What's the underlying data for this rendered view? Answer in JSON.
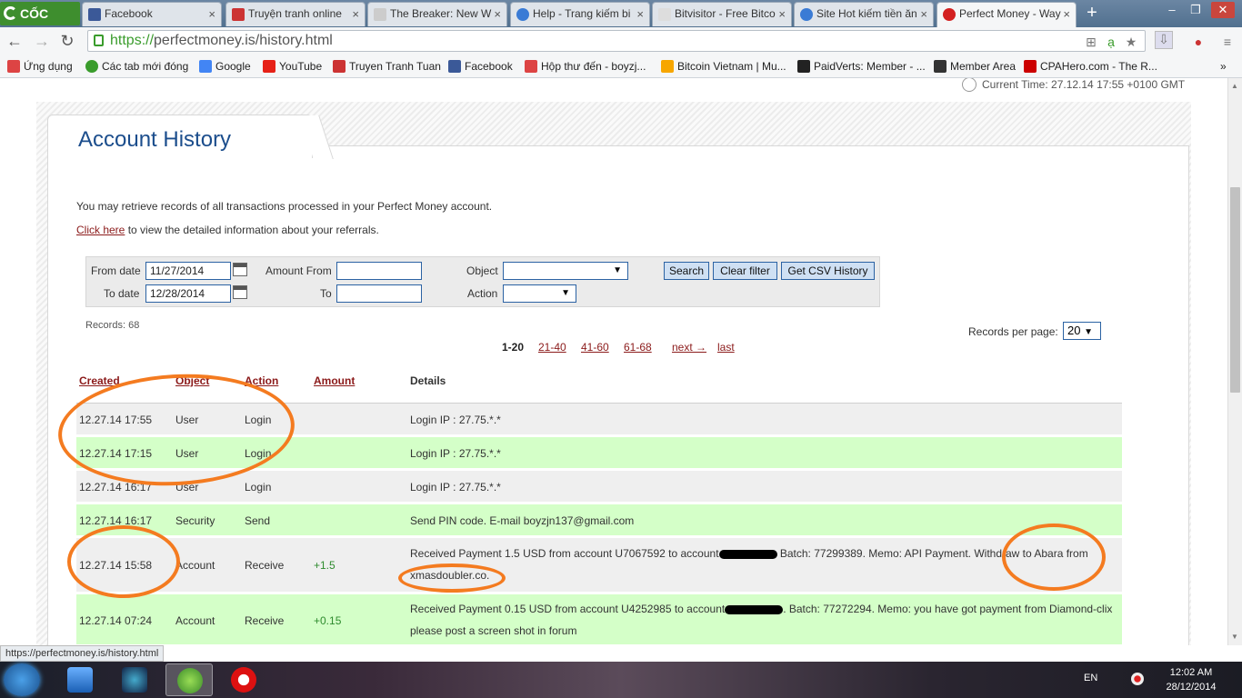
{
  "browser": {
    "logo": "CỐC CỐC",
    "tabs": [
      {
        "title": "Facebook",
        "fav": "#3b5998"
      },
      {
        "title": "Truyện tranh online",
        "fav": "#c33"
      },
      {
        "title": "The Breaker: New W",
        "fav": "#ccc"
      },
      {
        "title": "Help - Trang kiếm bi",
        "fav": "#3a7bd5"
      },
      {
        "title": "Bitvisitor - Free Bitco",
        "fav": "#ddd"
      },
      {
        "title": "Site Hot kiếm tiền ăn",
        "fav": "#3a7bd5"
      },
      {
        "title": "Perfect Money - Way",
        "fav": "#d32020"
      }
    ],
    "url_https": "https://",
    "url_rest": "perfectmoney.is/history.html",
    "bookmarks": [
      {
        "label": "Ứng dụng",
        "fav": "#d44"
      },
      {
        "label": "Các tab mới đóng",
        "fav": "#3a9c2c"
      },
      {
        "label": "Google",
        "fav": "#4285f4"
      },
      {
        "label": "YouTube",
        "fav": "#e62117"
      },
      {
        "label": "Truyen Tranh Tuan",
        "fav": "#c33"
      },
      {
        "label": "Facebook",
        "fav": "#3b5998"
      },
      {
        "label": "Hộp thư đến - boyzj...",
        "fav": "#d44"
      },
      {
        "label": "Bitcoin Vietnam | Mu...",
        "fav": "#f7a600"
      },
      {
        "label": "PaidVerts: Member - ...",
        "fav": "#222"
      },
      {
        "label": "Member Area",
        "fav": "#333"
      },
      {
        "label": "CPAHero.com - The R...",
        "fav": "#c00"
      }
    ]
  },
  "page": {
    "current_time": "Current Time: 27.12.14 17:55 +0100 GMT",
    "title": "Account History",
    "intro": "You may retrieve records of all transactions processed in your Perfect Money account.",
    "referral_link": "Click here",
    "referral_text": " to view the detailed information about your referrals."
  },
  "filter": {
    "from_date_label": "From date",
    "from_date": "11/27/2014",
    "to_date_label": "To date",
    "to_date": "12/28/2014",
    "amount_from_label": "Amount From",
    "amount_to_label": "To",
    "object_label": "Object",
    "action_label": "Action",
    "search_btn": "Search",
    "clear_btn": "Clear filter",
    "csv_btn": "Get CSV History"
  },
  "records": "Records: 68",
  "records_per_page_label": "Records per page:",
  "records_per_page": "20",
  "pager": [
    "1-20",
    "21-40",
    "41-60",
    "61-68",
    "next →",
    "last"
  ],
  "table": {
    "headers": [
      "Created",
      "Object",
      "Action",
      "Amount",
      "Details"
    ],
    "rows": [
      {
        "created": "12.27.14 17:55",
        "object": "User",
        "action": "Login",
        "amount": "",
        "details": "Login IP : 27.75.*.*"
      },
      {
        "created": "12.27.14 17:15",
        "object": "User",
        "action": "Login",
        "amount": "",
        "details": "Login IP : 27.75.*.*"
      },
      {
        "created": "12.27.14 16:17",
        "object": "User",
        "action": "Login",
        "amount": "",
        "details": "Login IP : 27.75.*.*"
      },
      {
        "created": "12.27.14 16:17",
        "object": "Security",
        "action": "Send",
        "amount": "",
        "details": "Send PIN code. E-mail boyzjn137@gmail.com"
      },
      {
        "created": "12.27.14 15:58",
        "object": "Account",
        "action": "Receive",
        "amount": "+1.5",
        "details_a": "Received Payment 1.5 USD from account U7067592 to account",
        "details_b": " Batch: 77299389. Memo: API Payment. Withdraw to Abara from xmasdoubler.co."
      },
      {
        "created": "12.27.14 07:24",
        "object": "Account",
        "action": "Receive",
        "amount": "+0.15",
        "details_a": "Received Payment 0.15 USD from account U4252985 to account",
        "details_b": ". Batch: 77272294. Memo: you have got payment from Diamond-clix please post a screen shot in forum"
      }
    ]
  },
  "status_url": "https://perfectmoney.is/history.html",
  "taskbar": {
    "lang": "EN",
    "time": "12:02 AM",
    "date": "28/12/2014"
  },
  "colors": {
    "accent": "#f47b20",
    "row_green": "#d4ffc8",
    "row_grey": "#efefef",
    "link": "#8b1a1a",
    "title": "#1b4d8c"
  }
}
